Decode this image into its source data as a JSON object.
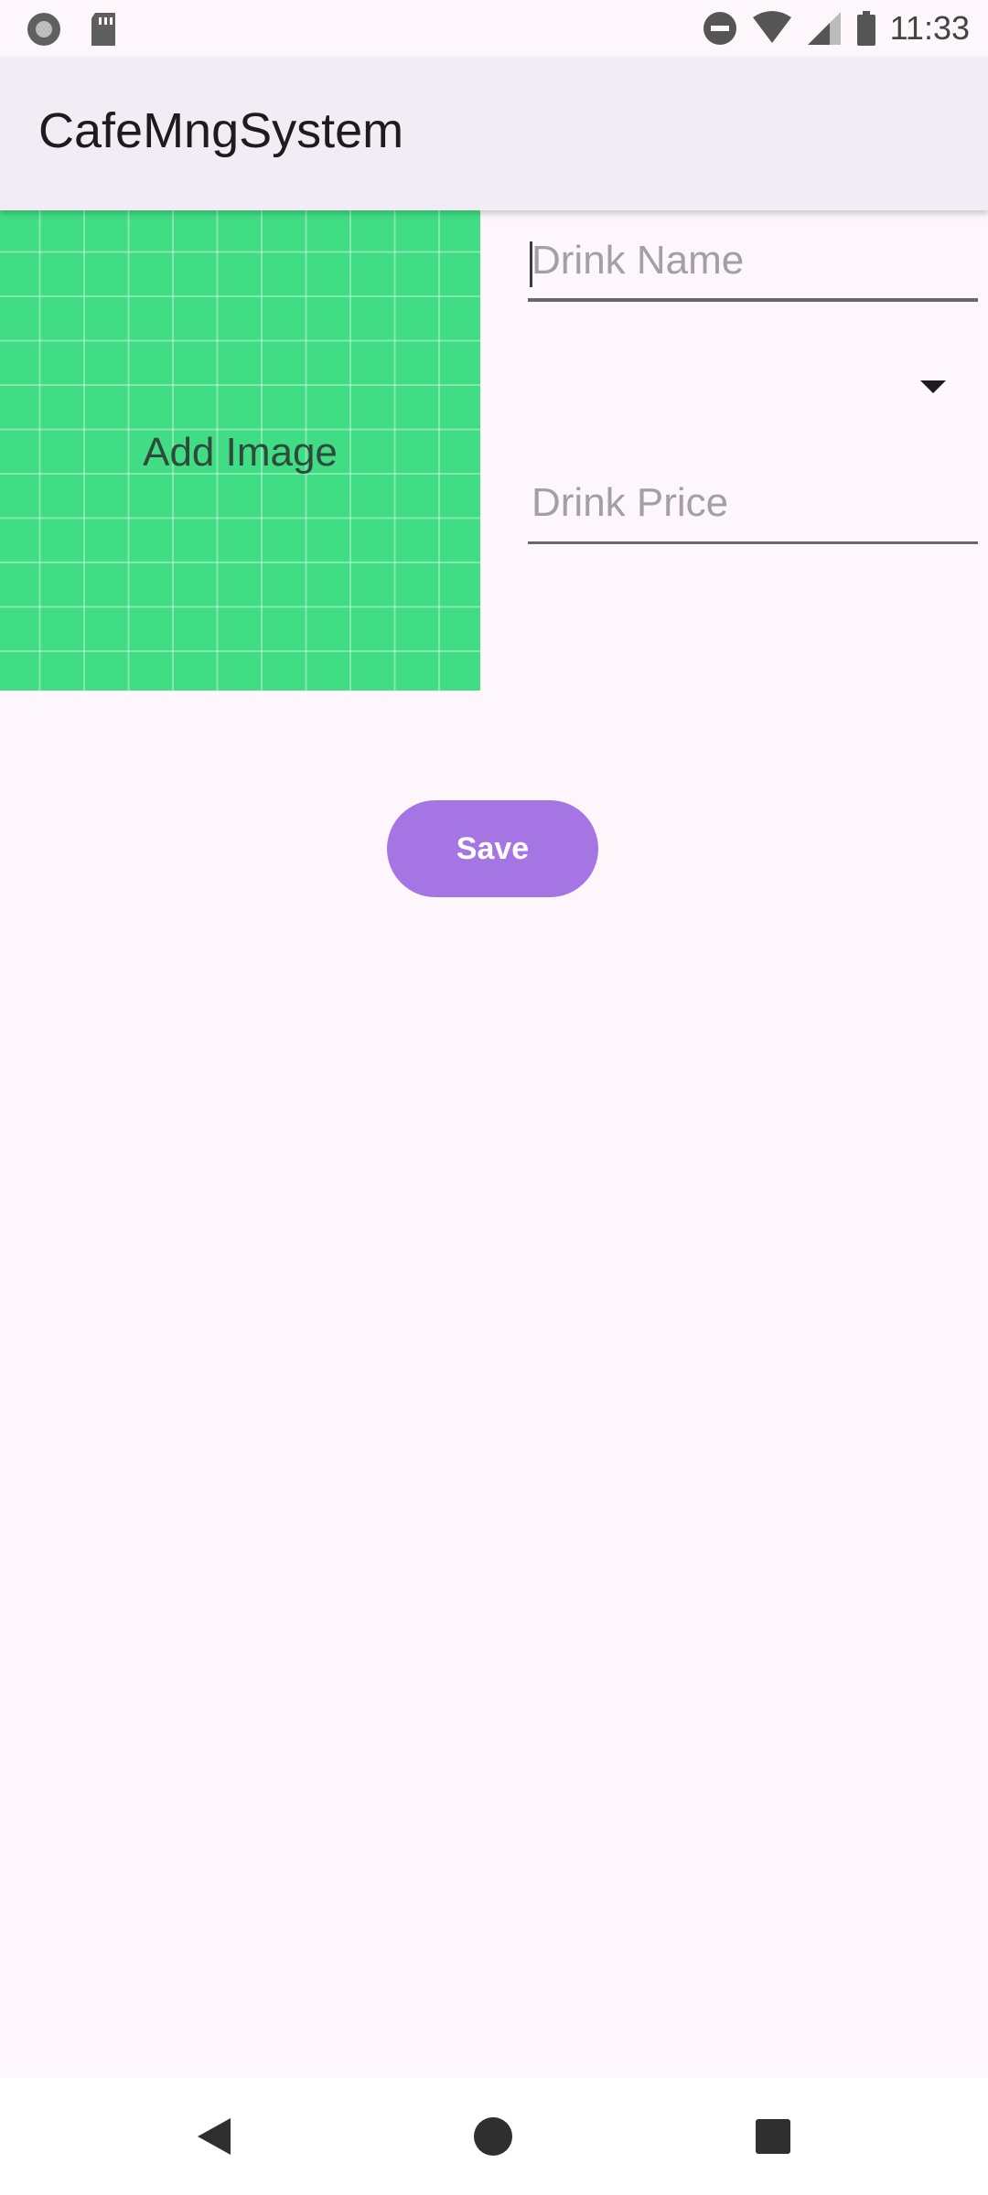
{
  "status_bar": {
    "time": "11:33",
    "icons": [
      "recording-icon",
      "sd-card-icon",
      "do-not-disturb-icon",
      "wifi-icon",
      "signal-icon",
      "battery-icon"
    ]
  },
  "app_bar": {
    "title": "CafeMngSystem"
  },
  "form": {
    "image_button_label": "Add Image",
    "image_bg_color": "#41dd85",
    "drink_name_placeholder": "Drink Name",
    "drink_name_value": "",
    "category_selected": "",
    "drink_price_placeholder": "Drink Price",
    "drink_price_value": "",
    "save_label": "Save",
    "save_color": "#a575e4"
  },
  "nav_bar": {
    "icons": [
      "back-icon",
      "home-icon",
      "recents-icon"
    ]
  }
}
